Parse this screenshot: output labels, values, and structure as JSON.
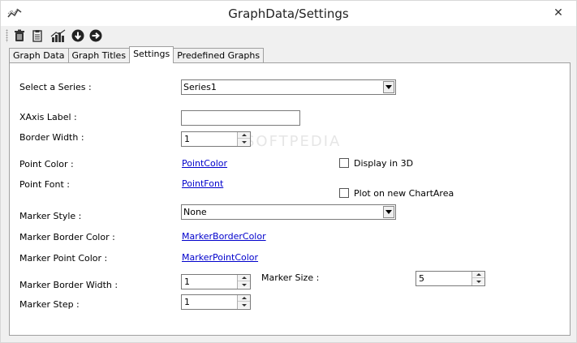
{
  "window": {
    "title": "GraphData/Settings",
    "close_glyph": "✕"
  },
  "toolbar": {
    "buttons": [
      "trash-icon",
      "clipboard-icon",
      "chart-icon",
      "download-icon",
      "forward-icon"
    ]
  },
  "tabs": [
    "Graph Data",
    "Graph Titles",
    "Settings",
    "Predefined Graphs"
  ],
  "active_tab": "Settings",
  "watermark": "SOFTPEDIA",
  "settings": {
    "series_label": "Select a Series :",
    "series_value": "Series1",
    "xaxis_label": "XAxis Label :",
    "xaxis_value": "",
    "border_width_label": "Border Width :",
    "border_width_value": "1",
    "point_color_label": "Point Color :",
    "point_color_link": "PointColor",
    "point_font_label": "Point Font :",
    "point_font_link": "PointFont",
    "display_3d_label": "Display in 3D",
    "display_3d_checked": false,
    "new_chartarea_label": "Plot on new ChartArea",
    "new_chartarea_checked": false,
    "marker_style_label": "Marker Style :",
    "marker_style_value": "None",
    "marker_border_color_label": "Marker Border Color :",
    "marker_border_color_link": "MarkerBorderColor",
    "marker_point_color_label": "Marker Point Color :",
    "marker_point_color_link": "MarkerPointColor",
    "marker_border_width_label": "Marker Border Width :",
    "marker_border_width_value": "1",
    "marker_size_label": "Marker Size :",
    "marker_size_value": "5",
    "marker_step_label": "Marker Step :",
    "marker_step_value": "1"
  },
  "colors": {
    "link": "#0000cc",
    "tab_active_bg": "#ffffff",
    "chrome_bg": "#f0f0f0"
  }
}
